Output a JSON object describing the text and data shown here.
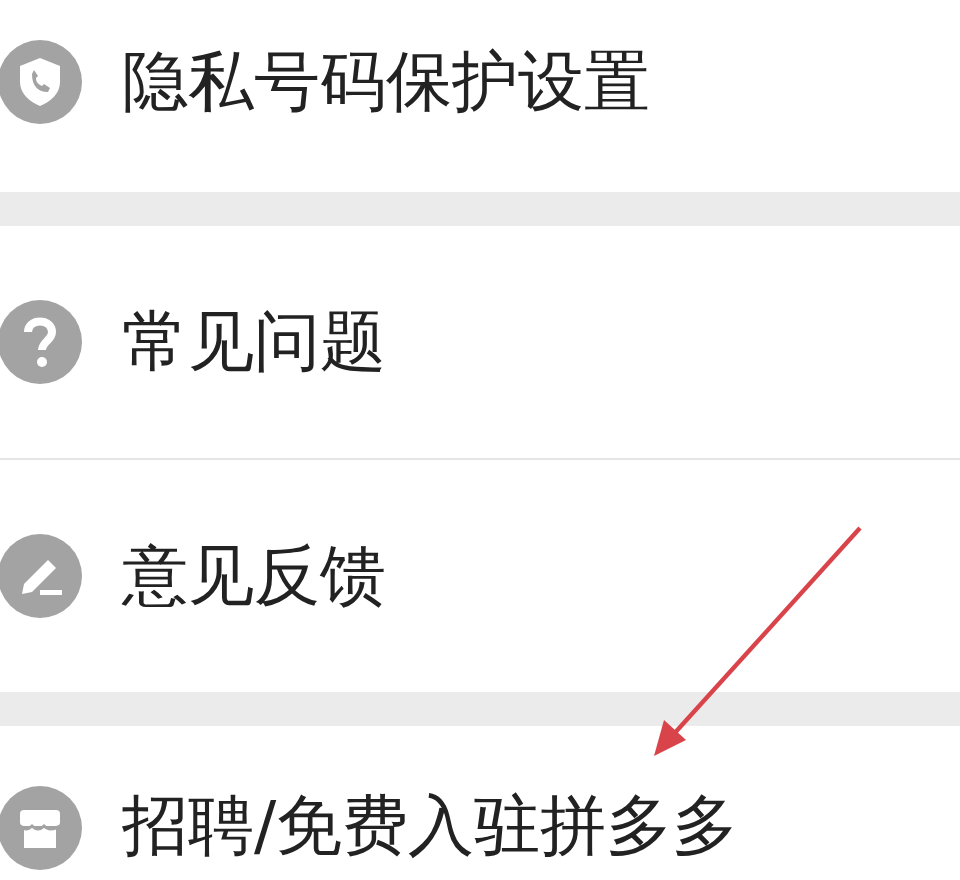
{
  "groups": [
    {
      "items": [
        {
          "label": "隐私号码保护设置"
        }
      ]
    },
    {
      "items": [
        {
          "label": "常见问题"
        },
        {
          "label": "意见反馈"
        }
      ]
    },
    {
      "items": [
        {
          "label": "招聘/免费入驻拼多多"
        }
      ]
    }
  ],
  "annotations": [
    {
      "kind": "arrow"
    }
  ]
}
